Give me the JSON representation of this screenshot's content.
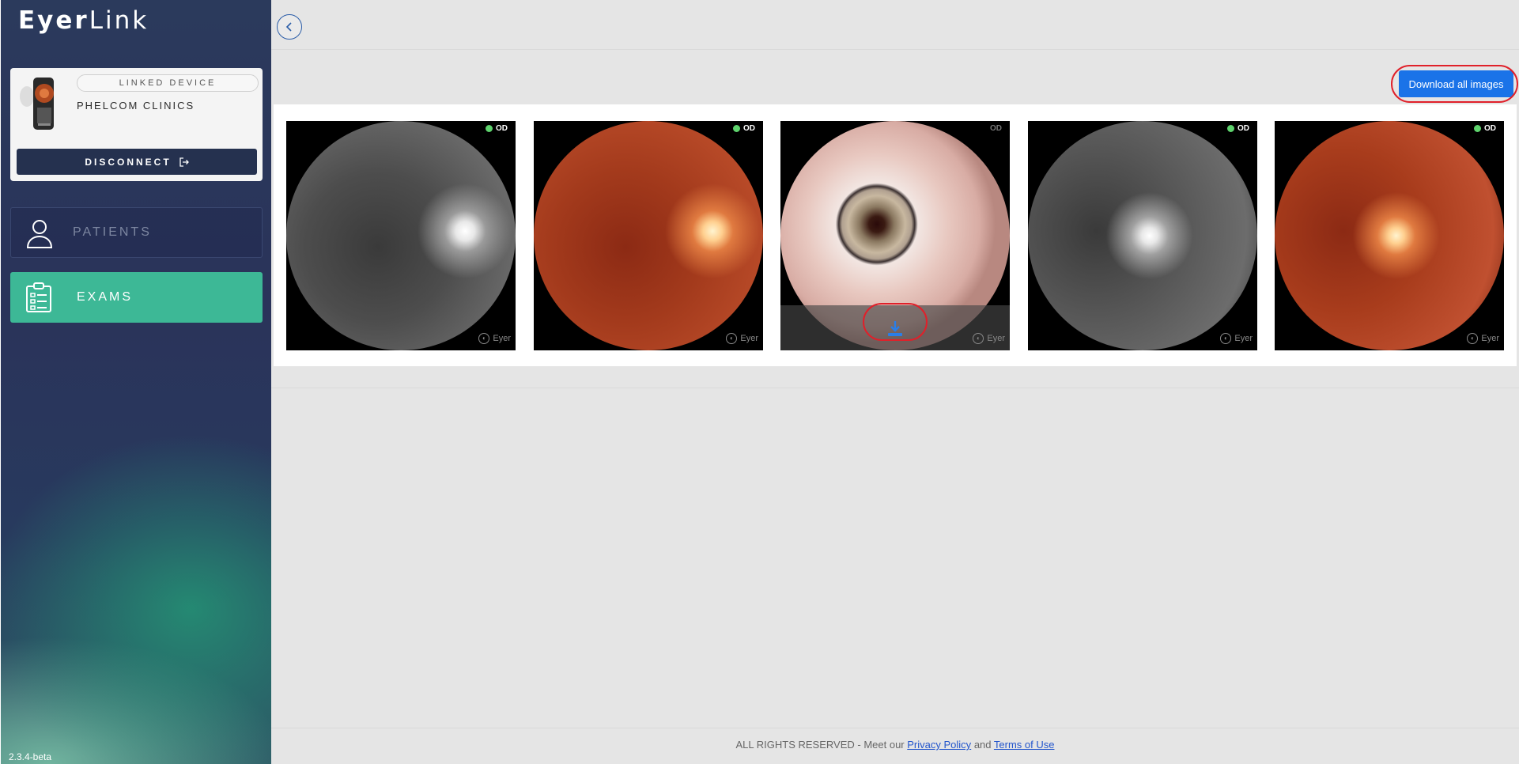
{
  "sidebar": {
    "logo_bold": "Eyer",
    "logo_light": "Link",
    "device": {
      "linked_label": "LINKED DEVICE",
      "clinic_name": "PHELCOM CLINICS",
      "disconnect_label": "DISCONNECT"
    },
    "nav": [
      {
        "label": "PATIENTS",
        "icon": "person-icon",
        "active": false
      },
      {
        "label": "EXAMS",
        "icon": "clipboard-checklist-icon",
        "active": true
      }
    ],
    "version": "2.3.4-beta"
  },
  "toolbar": {
    "back_icon": "chevron-left-icon",
    "download_all_label": "Download all images"
  },
  "images": [
    {
      "eye": "OD",
      "type": "red-free fundus",
      "status": "green",
      "watermark": "Eyer"
    },
    {
      "eye": "OD",
      "type": "color fundus",
      "status": "green",
      "watermark": "Eyer"
    },
    {
      "eye": "OD",
      "type": "anterior segment",
      "status": "none",
      "watermark": "Eyer",
      "hover_download_icon": "download-icon"
    },
    {
      "eye": "OD",
      "type": "red-free fundus",
      "status": "green",
      "watermark": "Eyer"
    },
    {
      "eye": "OD",
      "type": "color fundus",
      "status": "green",
      "watermark": "Eyer"
    }
  ],
  "footer": {
    "prefix": "ALL RIGHTS RESERVED - Meet our",
    "privacy_link": "Privacy Policy",
    "and": "and",
    "terms_link": "Terms of Use"
  },
  "colors": {
    "accent_blue": "#1a73e8",
    "exams_green": "#3db896",
    "disconnect_navy": "#25314f",
    "annotation_red": "#e0202a",
    "status_green": "#5ed36d"
  }
}
